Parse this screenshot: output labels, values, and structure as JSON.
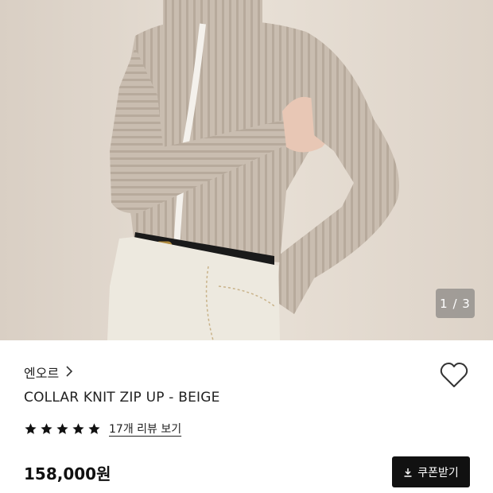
{
  "gallery": {
    "current_page": "1",
    "separator": "/",
    "total_pages": "3",
    "counter_text": "1 / 3"
  },
  "product": {
    "brand": "엔오르",
    "title": "COLLAR KNIT ZIP UP - BEIGE",
    "rating": 5,
    "review_link": "17개 리뷰 보기",
    "price": "158,000원",
    "coupon_label": "쿠폰받기"
  },
  "icons": {
    "brand_chevron": "chevron-right-icon",
    "wishlist": "heart-outline-icon",
    "star": "star-filled-icon",
    "download": "download-icon"
  },
  "colors": {
    "accent": "#111111",
    "background": "#ffffff",
    "photo_bg": "#e4dbd0"
  }
}
